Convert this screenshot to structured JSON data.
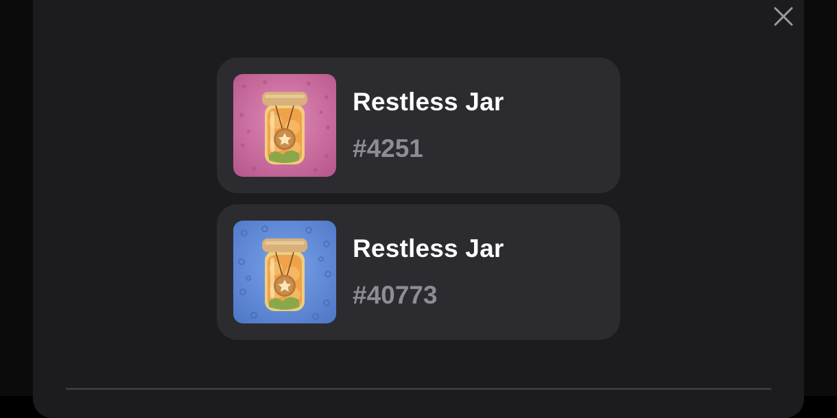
{
  "close_icon": "close-icon",
  "items": [
    {
      "title": "Restless Jar",
      "number": "#4251",
      "background_color": "#c5679a",
      "icon": "pickle-jar-icon"
    },
    {
      "title": "Restless Jar",
      "number": "#40773",
      "background_color": "#5a82d2",
      "icon": "pickle-jar-icon"
    }
  ]
}
